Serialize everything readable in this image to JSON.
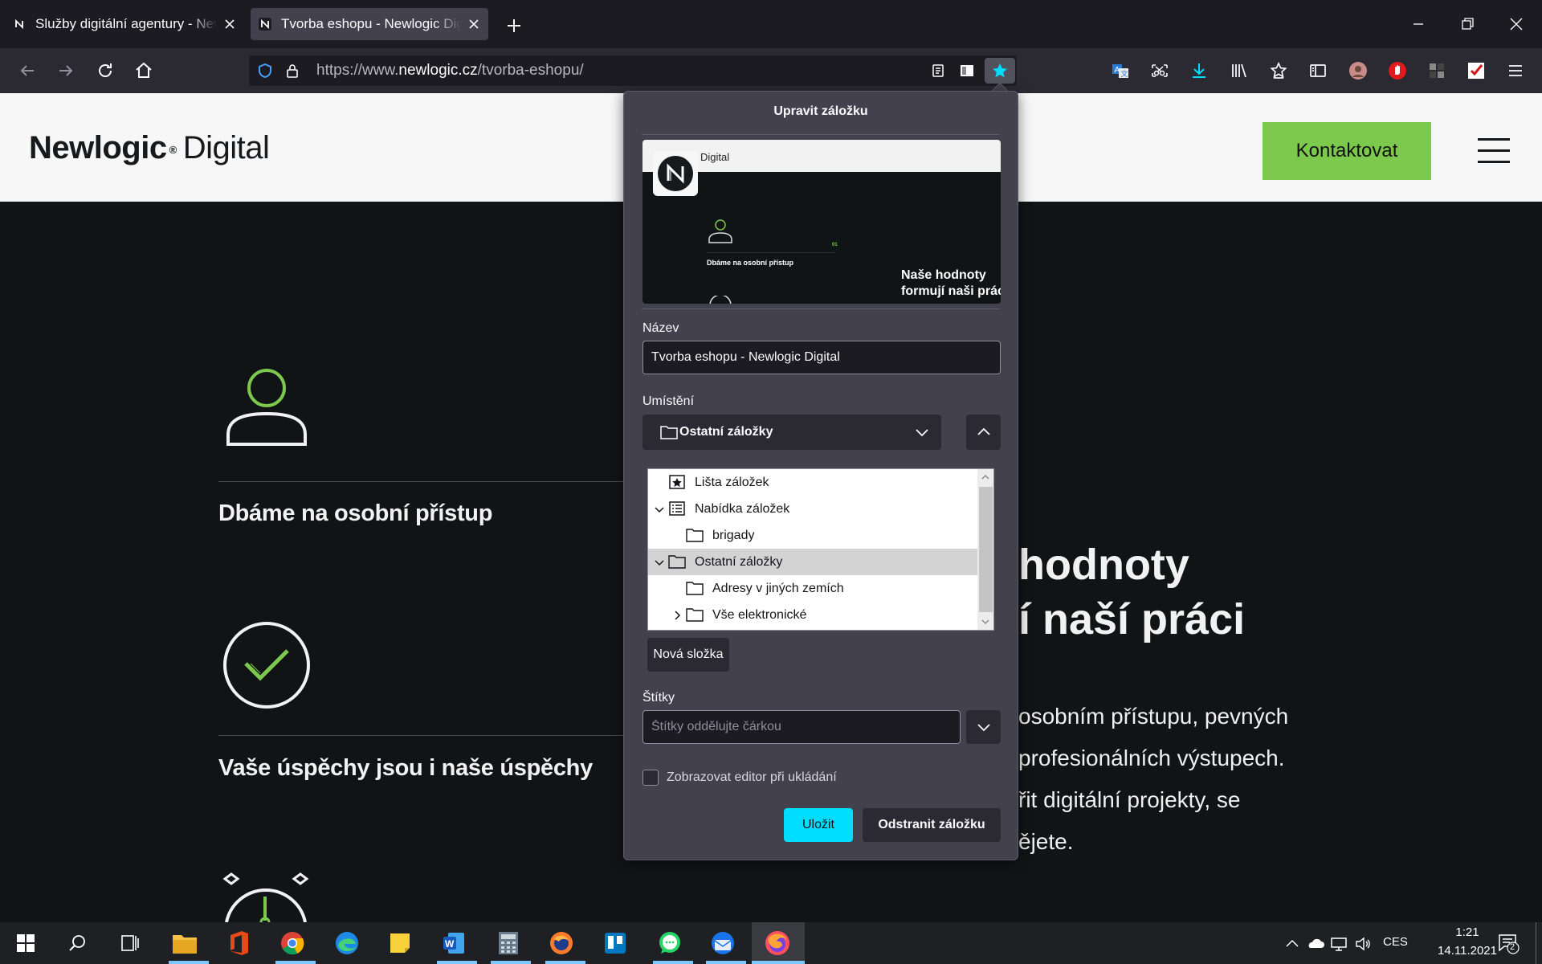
{
  "browser": {
    "tabs": [
      {
        "title": "Služby digitální agentury - Newlogic Digital"
      },
      {
        "title": "Tvorba eshopu - Newlogic Digital"
      }
    ],
    "url_prefix": "https://www.",
    "url_host": "newlogic.cz",
    "url_path": "/tvorba-eshopu/"
  },
  "site": {
    "logo_bold": "Newlogic",
    "logo_reg": "®",
    "logo_light": "Digital",
    "contact_button": "Kontaktovat",
    "features": [
      {
        "title": "Dbáme na osobní přístup",
        "icon": "person-icon"
      },
      {
        "title": "Vaše úspěchy jsou i naše úspěchy",
        "icon": "check-circle-icon"
      },
      {
        "title": "",
        "icon": "stopwatch-icon"
      }
    ],
    "heading_lines": [
      "hodnoty",
      "í naší práci"
    ],
    "paragraph_lines": [
      "osobním přístupu, pevných",
      "profesionálních výstupech.",
      "řit digitální projekty, se",
      "ějete."
    ]
  },
  "bookmark_panel": {
    "title": "Upravit záložku",
    "preview": {
      "logo_text": "Digital",
      "feature_text": "Dbáme na osobní přístup",
      "heading_line1": "Naše hodnoty",
      "heading_line2": "formují naši prác",
      "counter": "01"
    },
    "name_label": "Název",
    "name_value": "Tvorba eshopu - Newlogic Digital",
    "location_label": "Umístění",
    "location_value": "Ostatní záložky",
    "tree": [
      {
        "label": "Lišta záložek",
        "icon": "bookmarks-toolbar-icon",
        "twisty": ""
      },
      {
        "label": "Nabídka záložek",
        "icon": "bookmarks-menu-icon",
        "twisty": "open"
      },
      {
        "label": "brigady",
        "icon": "folder-icon",
        "twisty": ""
      },
      {
        "label": "Ostatní záložky",
        "icon": "folder-icon",
        "twisty": "open",
        "selected": true
      },
      {
        "label": "Adresy v jiných zemích",
        "icon": "folder-icon",
        "twisty": ""
      },
      {
        "label": "Vše elektronické",
        "icon": "folder-icon",
        "twisty": "closed"
      }
    ],
    "new_folder_button": "Nová složka",
    "tags_label": "Štítky",
    "tags_placeholder": "Štítky oddělujte čárkou",
    "show_editor_label": "Zobrazovat editor při ukládání",
    "show_editor_checked": false,
    "save_button": "Uložit",
    "remove_button": "Odstranit záložku"
  },
  "taskbar": {
    "language": "CES",
    "time": "1:21",
    "date": "14.11.2021",
    "notification_count": "2"
  },
  "colors": {
    "accent_green": "#7dc94e",
    "firefox_accent": "#00ddff",
    "page_dark": "#111415"
  }
}
